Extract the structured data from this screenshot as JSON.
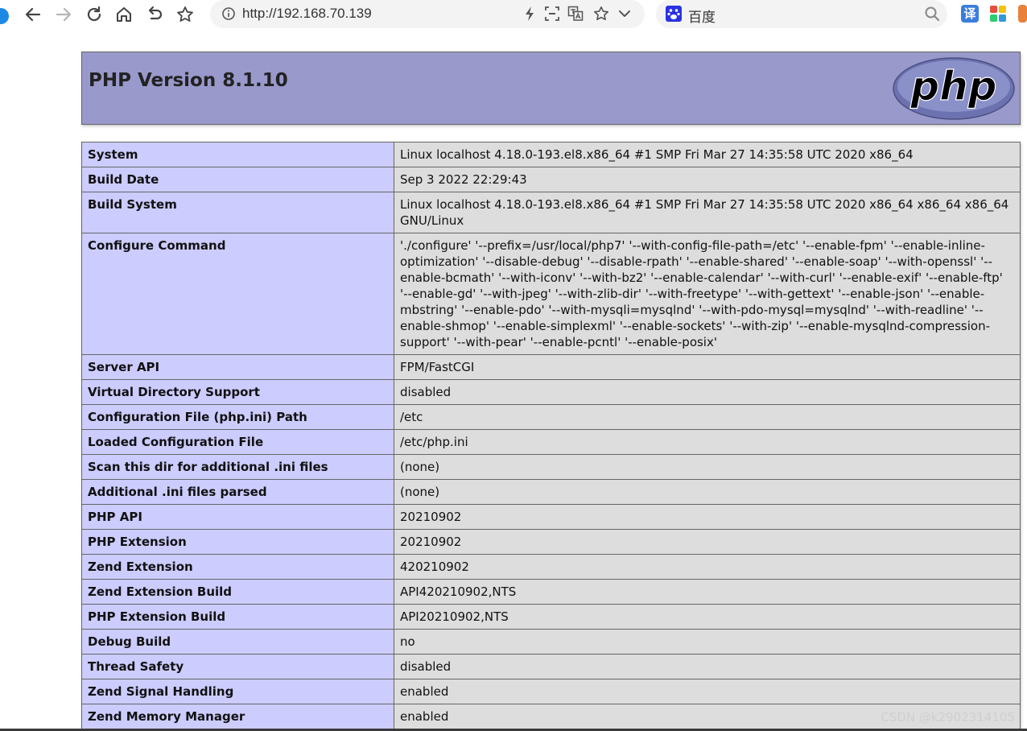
{
  "browser": {
    "url": "http://192.168.70.139",
    "search_placeholder": "百度",
    "ext_translate_label": "译"
  },
  "page": {
    "title": "PHP Version 8.1.10",
    "logo_text": "php"
  },
  "info_rows": [
    {
      "key": "System",
      "value": "Linux localhost 4.18.0-193.el8.x86_64 #1 SMP Fri Mar 27 14:35:58 UTC 2020 x86_64"
    },
    {
      "key": "Build Date",
      "value": "Sep 3 2022 22:29:43"
    },
    {
      "key": "Build System",
      "value": "Linux localhost 4.18.0-193.el8.x86_64 #1 SMP Fri Mar 27 14:35:58 UTC 2020 x86_64 x86_64 x86_64 GNU/Linux"
    },
    {
      "key": "Configure Command",
      "value": "'./configure' '--prefix=/usr/local/php7' '--with-config-file-path=/etc' '--enable-fpm' '--enable-inline-optimization' '--disable-debug' '--disable-rpath' '--enable-shared' '--enable-soap' '--with-openssl' '--enable-bcmath' '--with-iconv' '--with-bz2' '--enable-calendar' '--with-curl' '--enable-exif' '--enable-ftp' '--enable-gd' '--with-jpeg' '--with-zlib-dir' '--with-freetype' '--with-gettext' '--enable-json' '--enable-mbstring' '--enable-pdo' '--with-mysqli=mysqlnd' '--with-pdo-mysql=mysqlnd' '--with-readline' '--enable-shmop' '--enable-simplexml' '--enable-sockets' '--with-zip' '--enable-mysqlnd-compression-support' '--with-pear' '--enable-pcntl' '--enable-posix'"
    },
    {
      "key": "Server API",
      "value": "FPM/FastCGI"
    },
    {
      "key": "Virtual Directory Support",
      "value": "disabled"
    },
    {
      "key": "Configuration File (php.ini) Path",
      "value": "/etc"
    },
    {
      "key": "Loaded Configuration File",
      "value": "/etc/php.ini"
    },
    {
      "key": "Scan this dir for additional .ini files",
      "value": "(none)"
    },
    {
      "key": "Additional .ini files parsed",
      "value": "(none)"
    },
    {
      "key": "PHP API",
      "value": "20210902"
    },
    {
      "key": "PHP Extension",
      "value": "20210902"
    },
    {
      "key": "Zend Extension",
      "value": "420210902"
    },
    {
      "key": "Zend Extension Build",
      "value": "API420210902,NTS"
    },
    {
      "key": "PHP Extension Build",
      "value": "API20210902,NTS"
    },
    {
      "key": "Debug Build",
      "value": "no"
    },
    {
      "key": "Thread Safety",
      "value": "disabled"
    },
    {
      "key": "Zend Signal Handling",
      "value": "enabled"
    },
    {
      "key": "Zend Memory Manager",
      "value": "enabled"
    }
  ],
  "watermark": "CSDN @k2902314105",
  "colors": {
    "header_bg": "#9999cc",
    "key_cell_bg": "#ccccff",
    "value_cell_bg": "#dddddd"
  }
}
